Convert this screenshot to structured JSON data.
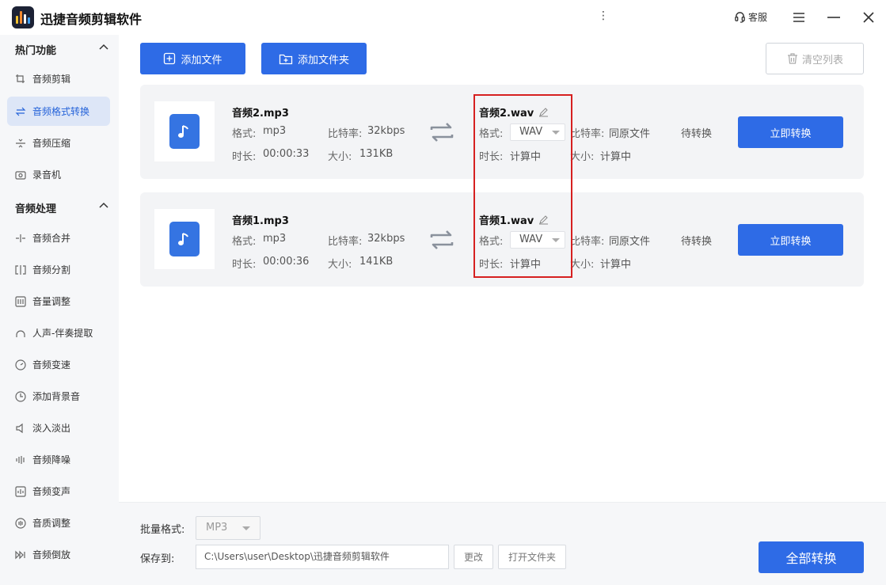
{
  "app": {
    "title": "迅捷音频剪辑软件"
  },
  "titlebar": {
    "service_label": "客服"
  },
  "colors": {
    "accent": "#2e6be6",
    "highlight": "#d62020",
    "active_bg": "#dde6f7"
  },
  "sidebar": {
    "section1": {
      "title": "热门功能"
    },
    "items1": [
      {
        "label": "音频剪辑",
        "icon": "cut-icon"
      },
      {
        "label": "音频格式转换",
        "icon": "convert-icon",
        "active": true
      },
      {
        "label": "音频压缩",
        "icon": "compress-icon"
      },
      {
        "label": "录音机",
        "icon": "recorder-icon"
      }
    ],
    "section2": {
      "title": "音频处理"
    },
    "items2": [
      {
        "label": "音频合并",
        "icon": "merge-icon"
      },
      {
        "label": "音频分割",
        "icon": "split-icon"
      },
      {
        "label": "音量调整",
        "icon": "volume-icon"
      },
      {
        "label": "人声-伴奏提取",
        "icon": "vocal-icon"
      },
      {
        "label": "音频变速",
        "icon": "speed-icon"
      },
      {
        "label": "添加背景音",
        "icon": "bgm-icon"
      },
      {
        "label": "淡入淡出",
        "icon": "fade-icon"
      },
      {
        "label": "音频降噪",
        "icon": "denoise-icon"
      },
      {
        "label": "音频变声",
        "icon": "voice-change-icon"
      },
      {
        "label": "音质调整",
        "icon": "quality-icon"
      },
      {
        "label": "音频倒放",
        "icon": "reverse-icon"
      }
    ]
  },
  "toolbar": {
    "add_file": "添加文件",
    "add_folder": "添加文件夹",
    "clear_list": "清空列表"
  },
  "files": [
    {
      "name": "音频2.mp3",
      "format_label": "格式:",
      "format": "mp3",
      "bitrate_label": "比特率:",
      "bitrate": "32kbps",
      "duration_label": "时长:",
      "duration": "00:00:33",
      "size_label": "大小:",
      "size": "131KB",
      "output_name": "音频2.wav",
      "output_format": "WAV",
      "output_bitrate": "同原文件",
      "output_duration": "计算中",
      "output_size": "计算中",
      "status": "待转换",
      "action": "立即转换"
    },
    {
      "name": "音频1.mp3",
      "format_label": "格式:",
      "format": "mp3",
      "bitrate_label": "比特率:",
      "bitrate": "32kbps",
      "duration_label": "时长:",
      "duration": "00:00:36",
      "size_label": "大小:",
      "size": "141KB",
      "output_name": "音频1.wav",
      "output_format": "WAV",
      "output_bitrate": "同原文件",
      "output_duration": "计算中",
      "output_size": "计算中",
      "status": "待转换",
      "action": "立即转换"
    }
  ],
  "bottom": {
    "batch_label": "批量格式:",
    "batch_format": "MP3",
    "save_label": "保存到:",
    "save_path": "C:\\Users\\user\\Desktop\\迅捷音频剪辑软件",
    "change": "更改",
    "open_folder": "打开文件夹",
    "convert_all": "全部转换"
  }
}
